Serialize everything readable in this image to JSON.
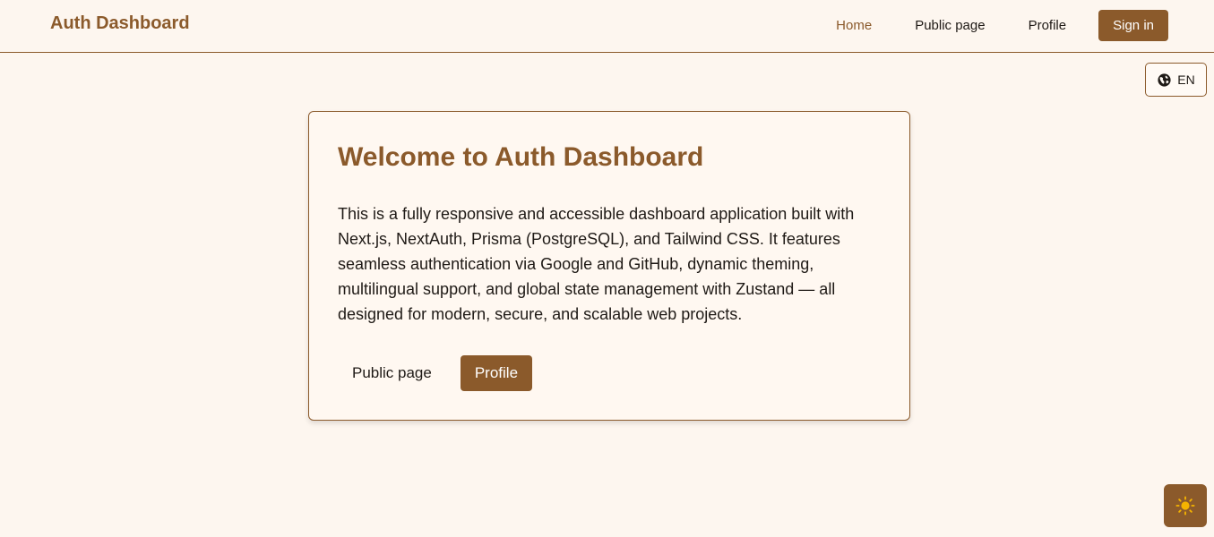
{
  "header": {
    "brand": "Auth Dashboard",
    "nav": {
      "home": "Home",
      "public_page": "Public page",
      "profile": "Profile",
      "sign_in": "Sign in"
    }
  },
  "language": {
    "label": "EN",
    "icon": "globe-icon"
  },
  "card": {
    "title": "Welcome to Auth Dashboard",
    "description": "This is a fully responsive and accessible dashboard application built with Next.js, NextAuth, Prisma (PostgreSQL), and Tailwind CSS. It features seamless authentication via Google and GitHub, dynamic theming, multilingual support, and global state management with Zustand — all designed for modern, secure, and scalable web projects.",
    "actions": {
      "public_page": "Public page",
      "profile": "Profile"
    }
  },
  "theme_toggle": {
    "icon": "sun-icon"
  },
  "colors": {
    "accent": "#8b5a2b",
    "background": "#fdf6ef",
    "sun": "#f5b400"
  }
}
